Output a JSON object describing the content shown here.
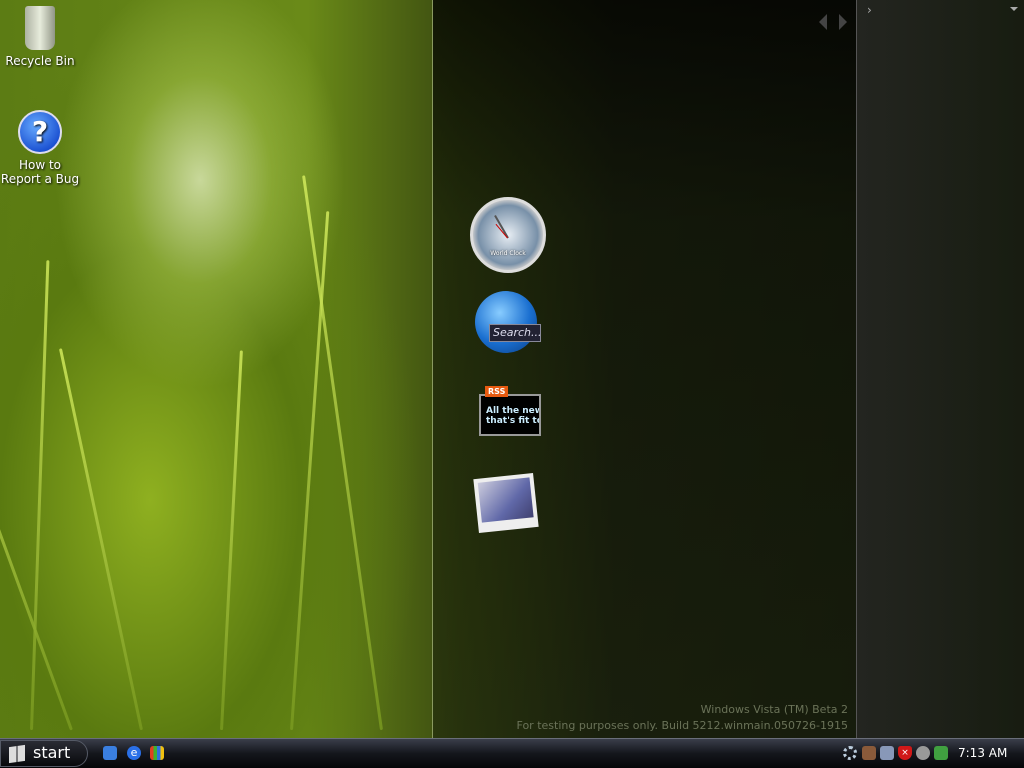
{
  "desktop": {
    "icons": [
      {
        "label": "Recycle Bin",
        "icon": "recycle-bin-icon"
      },
      {
        "label": "How to Report a Bug",
        "line1": "How to",
        "line2": "Report a Bug",
        "icon": "help-icon"
      }
    ]
  },
  "gallery": {
    "gadgets": [
      {
        "name": "World Clock",
        "icon": "clock-icon"
      },
      {
        "name": "Search",
        "text": "Search...",
        "icon": "globe-icon"
      },
      {
        "name": "RSS",
        "badge": "RSS",
        "line1": "All the new",
        "line2": "that's fit to",
        "icon": "rss-icon"
      },
      {
        "name": "Slideshow",
        "icon": "photo-icon"
      }
    ]
  },
  "watermark": {
    "line1": "Windows Vista (TM) Beta 2",
    "line2": "For testing purposes only. Build 5212.winmain.050726-1915"
  },
  "taskbar": {
    "start_label": "start",
    "clock": "7:13 AM"
  }
}
